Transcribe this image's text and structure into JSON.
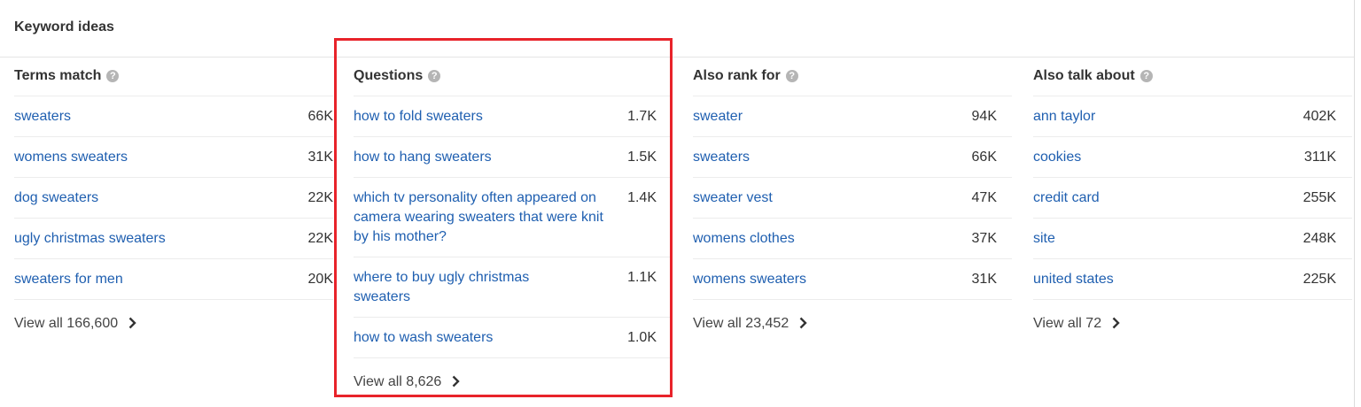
{
  "header": {
    "title": "Keyword ideas"
  },
  "columns": [
    {
      "title": "Terms match",
      "rows": [
        {
          "keyword": "sweaters",
          "volume": "66K"
        },
        {
          "keyword": "womens sweaters",
          "volume": "31K"
        },
        {
          "keyword": "dog sweaters",
          "volume": "22K"
        },
        {
          "keyword": "ugly christmas sweaters",
          "volume": "22K"
        },
        {
          "keyword": "sweaters for men",
          "volume": "20K"
        }
      ],
      "view_all": "View all 166,600"
    },
    {
      "title": "Questions",
      "rows": [
        {
          "keyword": "how to fold sweaters",
          "volume": "1.7K"
        },
        {
          "keyword": "how to hang sweaters",
          "volume": "1.5K"
        },
        {
          "keyword": "which tv personality often appeared on camera wearing sweaters that were knit by his mother?",
          "volume": "1.4K"
        },
        {
          "keyword": "where to buy ugly christmas sweaters",
          "volume": "1.1K"
        },
        {
          "keyword": "how to wash sweaters",
          "volume": "1.0K"
        }
      ],
      "view_all": "View all 8,626"
    },
    {
      "title": "Also rank for",
      "rows": [
        {
          "keyword": "sweater",
          "volume": "94K"
        },
        {
          "keyword": "sweaters",
          "volume": "66K"
        },
        {
          "keyword": "sweater vest",
          "volume": "47K"
        },
        {
          "keyword": "womens clothes",
          "volume": "37K"
        },
        {
          "keyword": "womens sweaters",
          "volume": "31K"
        }
      ],
      "view_all": "View all 23,452"
    },
    {
      "title": "Also talk about",
      "rows": [
        {
          "keyword": "ann taylor",
          "volume": "402K"
        },
        {
          "keyword": "cookies",
          "volume": "311K"
        },
        {
          "keyword": "credit card",
          "volume": "255K"
        },
        {
          "keyword": "site",
          "volume": "248K"
        },
        {
          "keyword": "united states",
          "volume": "225K"
        }
      ],
      "view_all": "View all 72"
    }
  ],
  "icons": {
    "help": "question-circle-icon",
    "view_all": "chevron-right-icon"
  },
  "colors": {
    "link": "#1f5fb0",
    "highlight": "#e8232a"
  },
  "highlighted_column": "Questions"
}
